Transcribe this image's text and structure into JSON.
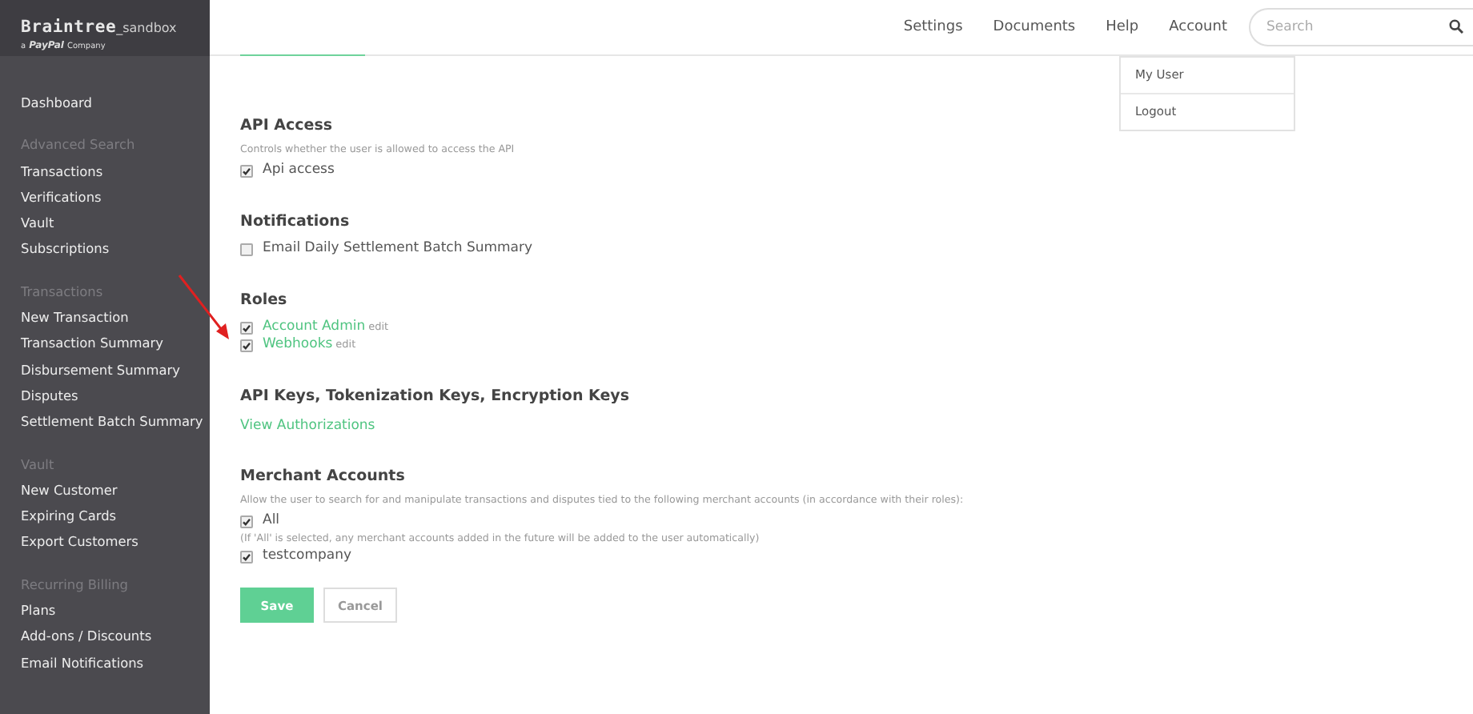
{
  "brand": {
    "name": "Braintree",
    "suffix": "_sandbox",
    "tagline_prefix": "a",
    "tagline_brand": "PayPal",
    "tagline_suffix": "Company"
  },
  "sidebar": {
    "groups": [
      {
        "items": [
          "Dashboard"
        ]
      },
      {
        "heading": "Advanced Search",
        "items": [
          "Transactions",
          "Verifications",
          "Vault",
          "Subscriptions"
        ]
      },
      {
        "heading": "Transactions",
        "items": [
          "New Transaction",
          "Transaction Summary",
          "Disbursement Summary",
          "Disputes",
          "Settlement Batch Summary"
        ]
      },
      {
        "heading": "Vault",
        "items": [
          "New Customer",
          "Expiring Cards",
          "Export Customers"
        ]
      },
      {
        "heading": "Recurring Billing",
        "items": [
          "Plans",
          "Add-ons / Discounts",
          "Email Notifications"
        ]
      }
    ]
  },
  "top_nav": {
    "links": [
      "Settings",
      "Documents",
      "Help",
      "Account"
    ],
    "search": {
      "placeholder": "Search"
    }
  },
  "account_menu": {
    "items": [
      "My User",
      "Logout"
    ]
  },
  "sections": [
    {
      "title": "API Access",
      "description": "Controls whether the user is allowed to access the API",
      "rows": [
        {
          "kind": "checkbox",
          "label": "Api access",
          "checked": true
        }
      ]
    },
    {
      "title": "Notifications",
      "rows": [
        {
          "kind": "checkbox",
          "label": "Email Daily Settlement Batch Summary",
          "checked": false
        }
      ]
    },
    {
      "title": "Roles",
      "rows": [
        {
          "kind": "role",
          "label": "Account Admin",
          "edit": "edit",
          "checked": true
        },
        {
          "kind": "role",
          "label": "Webhooks",
          "edit": "edit",
          "checked": true
        }
      ]
    },
    {
      "title": "API Keys, Tokenization Keys, Encryption Keys",
      "rows": [
        {
          "kind": "link",
          "label": "View Authorizations"
        }
      ]
    },
    {
      "title": "Merchant Accounts",
      "description": "Allow the user to search for and manipulate transactions and disputes tied to the following merchant accounts (in accordance with their roles):",
      "rows": [
        {
          "kind": "checkbox",
          "label": "All",
          "checked": true
        },
        {
          "kind": "note",
          "label": "(If 'All' is selected, any merchant accounts added in the future will be added to the user automatically)"
        },
        {
          "kind": "checkbox",
          "label": "testcompany",
          "checked": true
        }
      ]
    }
  ],
  "buttons": [
    {
      "label": "Save",
      "kind": "primary"
    },
    {
      "label": "Cancel",
      "kind": "secondary"
    }
  ]
}
